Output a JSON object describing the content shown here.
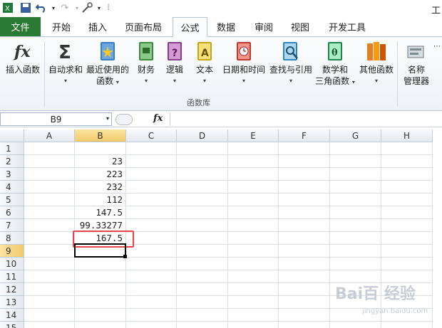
{
  "window": {
    "title": "工"
  },
  "tabs": {
    "file": "文件",
    "home": "开始",
    "insert": "插入",
    "layout": "页面布局",
    "formulas": "公式",
    "data": "数据",
    "review": "审阅",
    "view": "视图",
    "developer": "开发工具"
  },
  "ribbon": {
    "insert_function": "插入函数",
    "autosum": "自动求和",
    "recent": [
      "最近使用的",
      "函数"
    ],
    "financial": "财务",
    "logical": "逻辑",
    "text": "文本",
    "datetime": "日期和时间",
    "lookup": "查找与引用",
    "math": [
      "数学和",
      "三角函数"
    ],
    "more": "其他函数",
    "name_manager": [
      "名称",
      "管理器"
    ],
    "group_label": "函数库"
  },
  "formula_bar": {
    "namebox": "B9",
    "fx": "fx",
    "value": ""
  },
  "sheet": {
    "columns": [
      "A",
      "B",
      "C",
      "D",
      "E",
      "F",
      "G",
      "H"
    ],
    "rows": [
      "1",
      "2",
      "3",
      "4",
      "5",
      "6",
      "7",
      "8",
      "9",
      "10",
      "11",
      "12",
      "13",
      "14",
      "15"
    ],
    "b_values": [
      "",
      "23",
      "223",
      "232",
      "112",
      "147.5",
      "99.33277",
      "167.5",
      "",
      "",
      "",
      "",
      "",
      "",
      ""
    ],
    "selected_cell": "B9"
  },
  "watermark": {
    "text": "Bai百 经验",
    "sub": "jingyan.baidu.com"
  },
  "colors": {
    "file_tab": "#2a7a36",
    "highlight": "#e5454a",
    "header_selected": "#f2c96a"
  }
}
